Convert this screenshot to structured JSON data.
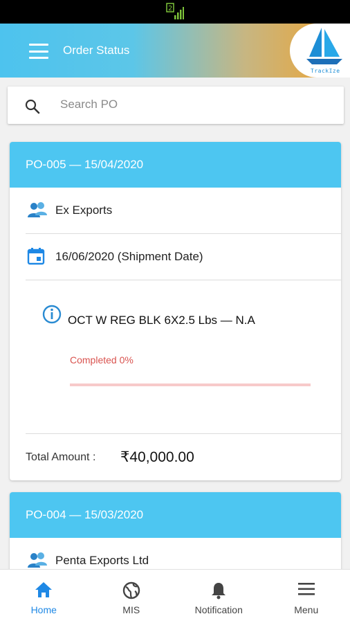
{
  "statusbar": {
    "icon": "signal-2-icon"
  },
  "appbar": {
    "title": "Order Status",
    "menu_icon": "hamburger-menu-icon",
    "logo_text": "TrackIze"
  },
  "search": {
    "placeholder": "Search PO",
    "value": "",
    "icon": "search-icon"
  },
  "orders": [
    {
      "header": "PO-005 — 15/04/2020",
      "buyer": "Ex Exports",
      "shipment": "16/06/2020 (Shipment Date)",
      "item": "OCT W REG BLK 6X2.5 Lbs — N.A",
      "progress_label": "Completed 0%",
      "progress": 0,
      "total_label": "Total Amount :",
      "total_value": "₹40,000.00"
    },
    {
      "header": "PO-004 — 15/03/2020",
      "buyer": "Penta Exports Ltd"
    }
  ],
  "bottom_nav": [
    {
      "label": "Home",
      "icon": "home-icon",
      "active": true
    },
    {
      "label": "MIS",
      "icon": "globe-icon",
      "active": false
    },
    {
      "label": "Notification",
      "icon": "bell-icon",
      "active": false
    },
    {
      "label": "Menu",
      "icon": "menu-lines-icon",
      "active": false
    }
  ],
  "colors": {
    "accent": "#4dc6f1",
    "active_nav": "#1e88e5",
    "progress": "#e74c3c",
    "brand_orange": "#f0a22c"
  }
}
